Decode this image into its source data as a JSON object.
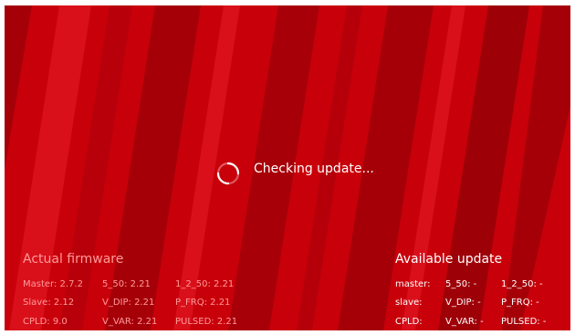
{
  "status": {
    "text": "Checking update...",
    "icon": "loading-spinner-icon"
  },
  "actual_firmware": {
    "title": "Actual firmware",
    "rows": [
      [
        "Master: 2.7.2",
        "5_50: 2.21",
        "1_2_50: 2.21"
      ],
      [
        "Slave: 2.12",
        "V_DIP: 2.21",
        "P_FRQ: 2.21"
      ],
      [
        "CPLD: 9.0",
        "V_VAR: 2.21",
        "PULSED: 2.21"
      ]
    ]
  },
  "available_update": {
    "title": "Available update",
    "rows": [
      [
        "master:",
        "5_50: -",
        "1_2_50: -"
      ],
      [
        "slave:",
        "V_DIP: -",
        "P_FRQ: -"
      ],
      [
        "CPLD:",
        "V_VAR: -",
        "PULSED: -"
      ]
    ]
  },
  "colors": {
    "background": "#c8000a",
    "stripe_dark": "#a50008",
    "stripe_light": "#d9101a",
    "muted_text": "#ff9a9a",
    "text": "#ffffff"
  }
}
